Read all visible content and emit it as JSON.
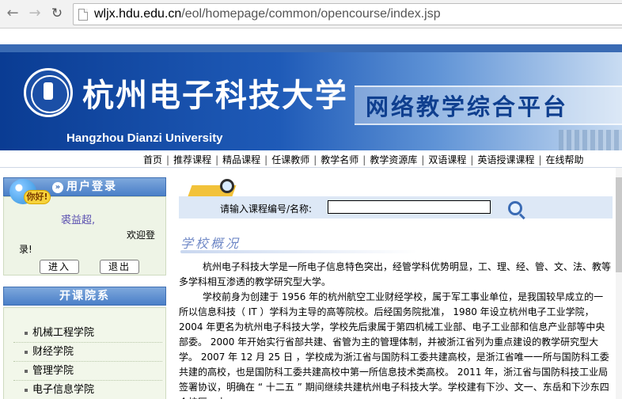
{
  "browser": {
    "url_host": "wljx.hdu.edu.cn",
    "url_path": "/eol/homepage/common/opencourse/index.jsp"
  },
  "banner": {
    "school_name_cn": "杭州电子科技大学",
    "school_name_en": "Hangzhou Dianzi University",
    "platform_title": "网络教学综合平台",
    "colors": {
      "primary": "#1f5bb8",
      "dark": "#0a3c93",
      "light": "#c9dcf2"
    }
  },
  "nav": {
    "items": [
      "首页",
      "推荐课程",
      "精品课程",
      "任课教师",
      "教学名师",
      "教学资源库",
      "双语课程",
      "英语授课课程",
      "在线帮助"
    ]
  },
  "login": {
    "title": "用户登录",
    "greeting_bubble": "你好!",
    "user_name": "裘益超,",
    "welcome": "欢迎登",
    "welcome_cont": "录!",
    "login_button": "进入",
    "exit_button": "退出"
  },
  "departments": {
    "title": "开课院系",
    "items": [
      "机械工程学院",
      "财经学院",
      "管理学院",
      "电子信息学院"
    ]
  },
  "search": {
    "label": "请输入课程编号/名称:",
    "value": ""
  },
  "overview": {
    "title": "学校概况",
    "paragraph1": "杭州电子科技大学是一所电子信息特色突出，经管学科优势明显，工、理、经、管、文、法、教等多学科相互渗透的教学研究型大学。",
    "paragraph2": "学校前身为创建于 1956 年的杭州航空工业财经学校，属于军工事业单位，是我国较早成立的一所以信息科技（ IT ）学科为主导的高等院校。后经国务院批准， 1980 年设立杭州电子工业学院， 2004 年更名为杭州电子科技大学，学校先后隶属于第四机械工业部、电子工业部和信息产业部等中央部委。 2000 年开始实行省部共建、省管为主的管理体制，并被浙江省列为重点建设的教学研究型大学。 2007 年 12 月 25 日 ，学校成为浙江省与国防科工委共建高校，是浙江省唯一一所与国防科工委共建的高校，也是国防科工委共建高校中第一所信息技术类高校。 2011 年，浙江省与国防科技工业局签署协议，明确在 “ 十二五 ” 期间继续共建杭州电子科技大学。学校建有下沙、文一、东岳和下沙东四个校区，占"
  }
}
